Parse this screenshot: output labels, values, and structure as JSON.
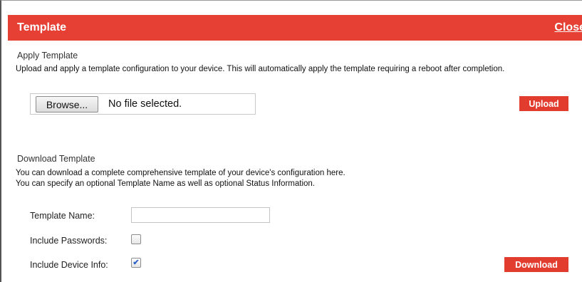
{
  "header": {
    "title": "Template",
    "close_label": "Close"
  },
  "apply": {
    "title": "Apply Template",
    "description": "Upload and apply a template configuration to your device. This will automatically apply the template requiring a reboot after completion.",
    "browse_label": "Browse...",
    "file_status": "No file selected.",
    "upload_label": "Upload"
  },
  "download": {
    "title": "Download Template",
    "description_line1": "You can download a complete comprehensive template of your device's configuration here.",
    "description_line2": "You can specify an optional Template Name as well as optional Status Information.",
    "template_name_label": "Template Name:",
    "template_name_value": "",
    "include_passwords_label": "Include Passwords:",
    "include_passwords_checked": false,
    "include_device_info_label": "Include Device Info:",
    "include_device_info_checked": true,
    "download_label": "Download"
  },
  "colors": {
    "accent": "#e64035",
    "button": "#e23c2f",
    "checkmark": "#2d62c9"
  }
}
